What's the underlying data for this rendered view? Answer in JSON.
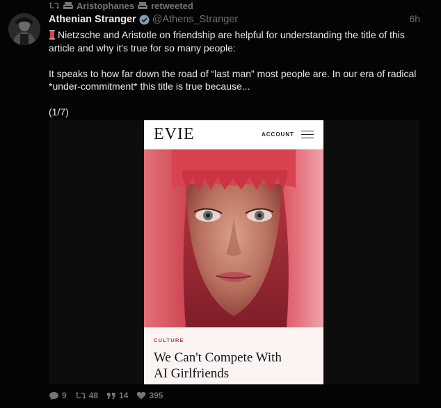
{
  "retweet": {
    "name": "Aristophanes",
    "suffix": "retweeted",
    "icon": "retweet-icon"
  },
  "tweet": {
    "author_name": "Athenian Stranger",
    "handle": "@Athens_Stranger",
    "time": "6h",
    "verified": true,
    "para1": "Nietzsche and Aristotle on friendship are helpful for understanding the title of this article and why it's true for so many people:",
    "para2": "It speaks to how far down the road of “last man” most people are. In our era of radical *under-commitment* this title is true because...",
    "para3": "(1/7)"
  },
  "media": {
    "site_logo": "EVIE",
    "account_label": "ACCOUNT",
    "category": "CULTURE",
    "headline_line1": "We Can't Compete With",
    "headline_line2": "AI Girlfriends"
  },
  "actions": {
    "replies": "9",
    "retweets": "48",
    "quotes": "14",
    "likes": "395"
  },
  "colors": {
    "background": "#040404",
    "muted": "#71767b",
    "text": "#e7e9ea",
    "verified": "#829aab",
    "category": "#b33a4a"
  }
}
